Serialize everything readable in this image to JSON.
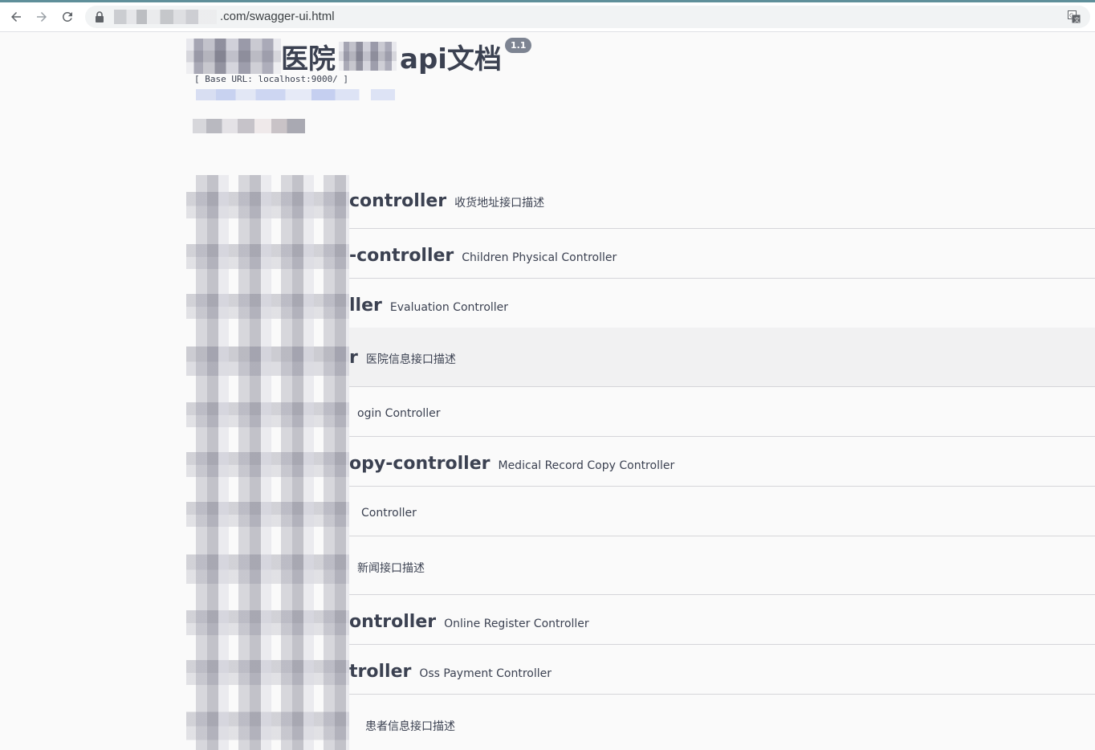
{
  "browser": {
    "url_visible": ".com/swagger-ui.html",
    "back_icon": "back-arrow-icon",
    "forward_icon": "forward-arrow-icon",
    "reload_icon": "reload-icon",
    "lock_icon": "lock-icon",
    "translate_icon": "translate-icon"
  },
  "info": {
    "title_part1": "医院",
    "title_part2": "api文档",
    "version": "1.1",
    "base_url": "[ Base URL: localhost:9000/ ]"
  },
  "tags": [
    {
      "name": "controller",
      "description": "收货地址接口描述"
    },
    {
      "name": "-controller",
      "description": "Children Physical Controller"
    },
    {
      "name": "ller",
      "description": "Evaluation Controller"
    },
    {
      "name": "r",
      "description": "医院信息接口描述"
    },
    {
      "name": "",
      "description": "ogin Controller"
    },
    {
      "name": "opy-controller",
      "description": "Medical Record Copy Controller"
    },
    {
      "name": "",
      "description": "Controller"
    },
    {
      "name": "",
      "description": "新闻接口描述"
    },
    {
      "name": "ontroller",
      "description": "Online Register Controller"
    },
    {
      "name": "troller",
      "description": "Oss Payment Controller"
    },
    {
      "name": "",
      "description": "患者信息接口描述"
    }
  ],
  "colors": {
    "text": "#3b4151",
    "background": "#fafafa",
    "badge": "#7d8492",
    "divider": "#d5d5d9"
  }
}
